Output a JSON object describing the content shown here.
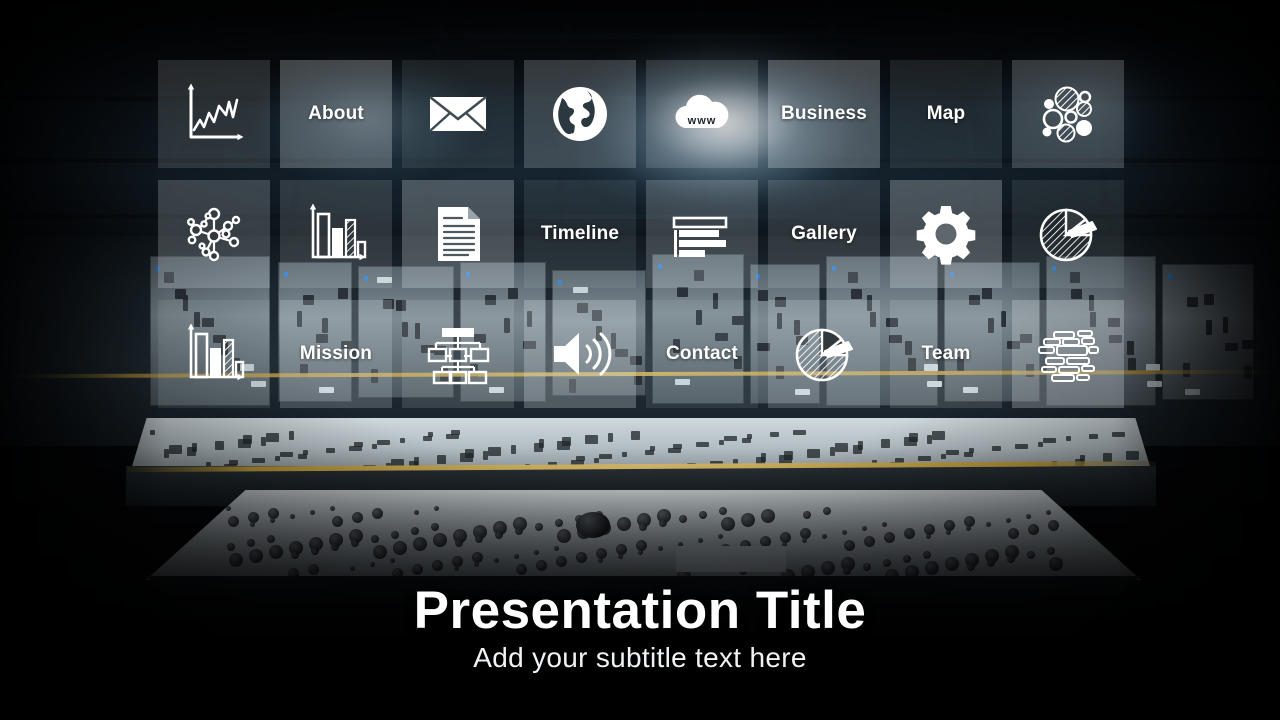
{
  "slide": {
    "title": "Presentation Title",
    "subtitle": "Add your subtitle text here",
    "background_scene": "industrial control room",
    "accent_color": "#d8bb62",
    "tile_text_color": "#ffffff"
  },
  "grid": {
    "rows": 3,
    "columns": 8,
    "tiles": [
      {
        "id": "tile-line-chart",
        "type": "icon",
        "icon": "line-chart-icon",
        "label": ""
      },
      {
        "id": "tile-about",
        "type": "label",
        "icon": "",
        "label": "About"
      },
      {
        "id": "tile-envelope",
        "type": "icon",
        "icon": "envelope-icon",
        "label": ""
      },
      {
        "id": "tile-globe",
        "type": "icon",
        "icon": "globe-icon",
        "label": ""
      },
      {
        "id": "tile-cloud-www",
        "type": "icon",
        "icon": "cloud-www-icon",
        "label": ""
      },
      {
        "id": "tile-business",
        "type": "label",
        "icon": "",
        "label": "Business"
      },
      {
        "id": "tile-map",
        "type": "label",
        "icon": "",
        "label": "Map"
      },
      {
        "id": "tile-bubble-chart",
        "type": "icon",
        "icon": "bubble-chart-icon",
        "label": ""
      },
      {
        "id": "tile-network",
        "type": "icon",
        "icon": "network-nodes-icon",
        "label": ""
      },
      {
        "id": "tile-bar-chart-a",
        "type": "icon",
        "icon": "bar-chart-icon",
        "label": ""
      },
      {
        "id": "tile-document",
        "type": "icon",
        "icon": "document-icon",
        "label": ""
      },
      {
        "id": "tile-timeline",
        "type": "label",
        "icon": "",
        "label": "Timeline"
      },
      {
        "id": "tile-gantt",
        "type": "icon",
        "icon": "gantt-bars-icon",
        "label": ""
      },
      {
        "id": "tile-gallery",
        "type": "label",
        "icon": "",
        "label": "Gallery"
      },
      {
        "id": "tile-gear",
        "type": "icon",
        "icon": "gear-icon",
        "label": ""
      },
      {
        "id": "tile-pie-chart-a",
        "type": "icon",
        "icon": "pie-chart-icon",
        "label": ""
      },
      {
        "id": "tile-bar-chart-b",
        "type": "icon",
        "icon": "bar-chart-icon",
        "label": ""
      },
      {
        "id": "tile-mission",
        "type": "label",
        "icon": "",
        "label": "Mission"
      },
      {
        "id": "tile-org-chart",
        "type": "icon",
        "icon": "org-chart-icon",
        "label": ""
      },
      {
        "id": "tile-speaker",
        "type": "icon",
        "icon": "speaker-volume-icon",
        "label": ""
      },
      {
        "id": "tile-contact",
        "type": "label",
        "icon": "",
        "label": "Contact"
      },
      {
        "id": "tile-pie-chart-b",
        "type": "icon",
        "icon": "pie-chart-icon",
        "label": ""
      },
      {
        "id": "tile-team",
        "type": "label",
        "icon": "",
        "label": "Team"
      },
      {
        "id": "tile-word-cloud",
        "type": "icon",
        "icon": "word-cloud-icon",
        "label": ""
      }
    ]
  }
}
